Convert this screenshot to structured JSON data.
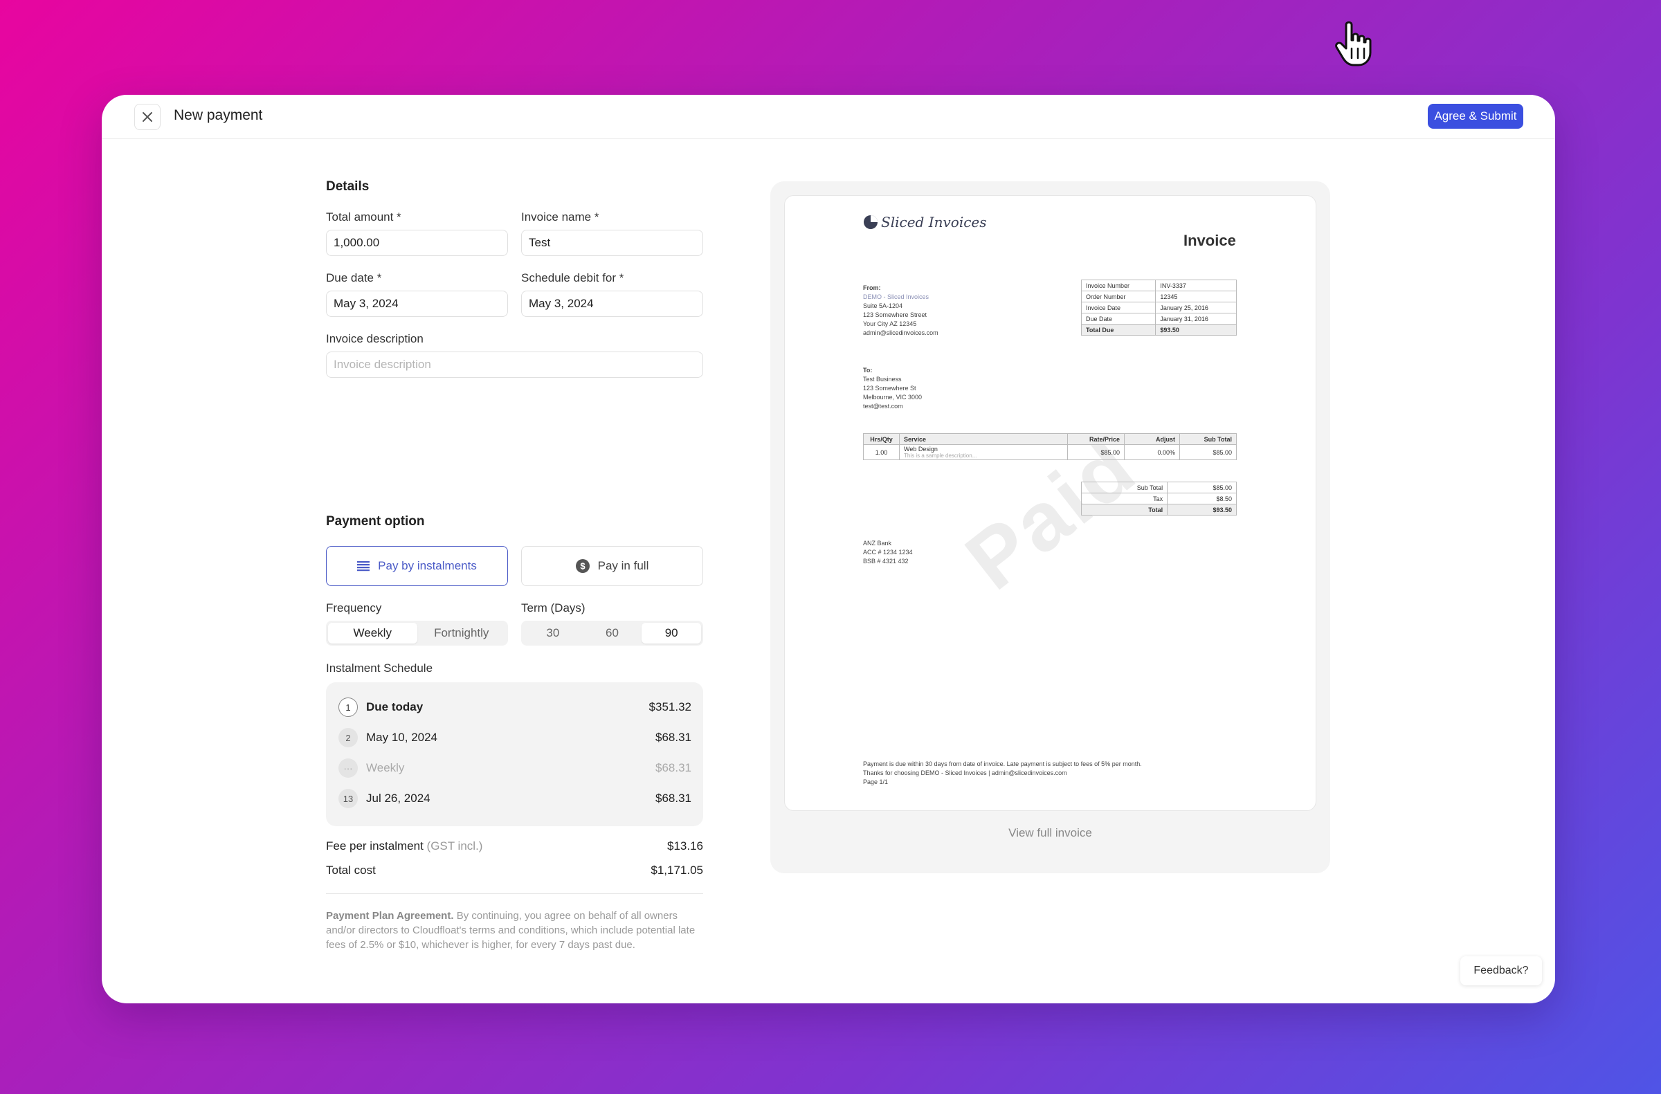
{
  "header": {
    "title": "New payment",
    "submit_label": "Agree & Submit"
  },
  "details": {
    "section_title": "Details",
    "total_amount": {
      "label": "Total amount *",
      "value": "1,000.00"
    },
    "invoice_name": {
      "label": "Invoice name *",
      "value": "Test"
    },
    "due_date": {
      "label": "Due date *",
      "value": "May 3, 2024"
    },
    "schedule_debit": {
      "label": "Schedule debit for *",
      "value": "May 3, 2024"
    },
    "description": {
      "label": "Invoice description",
      "placeholder": "Invoice description"
    }
  },
  "payment_option": {
    "section_title": "Payment option",
    "instalments_label": "Pay by instalments",
    "full_label": "Pay in full",
    "selected": "instalments",
    "frequency": {
      "label": "Frequency",
      "options": [
        "Weekly",
        "Fortnightly"
      ],
      "selected": "Weekly"
    },
    "term": {
      "label": "Term (Days)",
      "options": [
        "30",
        "60",
        "90"
      ],
      "selected": "90"
    }
  },
  "schedule": {
    "label": "Instalment Schedule",
    "rows": [
      {
        "num": "1",
        "date": "Due today",
        "amount": "$351.32"
      },
      {
        "num": "2",
        "date": "May 10, 2024",
        "amount": "$68.31"
      },
      {
        "num": "···",
        "date": "Weekly",
        "amount": "$68.31"
      },
      {
        "num": "13",
        "date": "Jul 26, 2024",
        "amount": "$68.31"
      }
    ]
  },
  "summary": {
    "fee_label": "Fee per instalment",
    "fee_note": "(GST incl.)",
    "fee_value": "$13.16",
    "total_label": "Total cost",
    "total_value": "$1,171.05"
  },
  "legal": {
    "title": "Payment Plan Agreement.",
    "body": "By continuing, you agree on behalf of all owners and/or directors to Cloudfloat's terms and conditions, which include potential late fees of 2.5% or $10, whichever is higher, for every 7 days past due."
  },
  "preview": {
    "view_full": "View full invoice",
    "logo_text": "Sliced Invoices",
    "doc_title": "Invoice",
    "watermark": "Paid",
    "from": {
      "label": "From:",
      "lines": [
        "DEMO - Sliced Invoices",
        "Suite 5A-1204",
        "123 Somewhere Street",
        "Your City AZ 12345",
        "admin@slicedinvoices.com"
      ]
    },
    "meta": [
      [
        "Invoice Number",
        "INV-3337"
      ],
      [
        "Order Number",
        "12345"
      ],
      [
        "Invoice Date",
        "January 25, 2016"
      ],
      [
        "Due Date",
        "January 31, 2016"
      ],
      [
        "Total Due",
        "$93.50"
      ]
    ],
    "to": {
      "label": "To:",
      "lines": [
        "Test Business",
        "123 Somewhere St",
        "Melbourne, VIC 3000",
        "test@test.com"
      ]
    },
    "items_head": [
      "Hrs/Qty",
      "Service",
      "Rate/Price",
      "Adjust",
      "Sub Total"
    ],
    "items": [
      {
        "qty": "1.00",
        "service": "Web Design",
        "desc": "This is a sample description...",
        "rate": "$85.00",
        "adjust": "0.00%",
        "subtotal": "$85.00"
      }
    ],
    "totals": [
      [
        "Sub Total",
        "$85.00"
      ],
      [
        "Tax",
        "$8.50"
      ],
      [
        "Total",
        "$93.50"
      ]
    ],
    "bank": [
      "ANZ Bank",
      "ACC # 1234 1234",
      "BSB # 4321 432"
    ],
    "footer": [
      "Payment is due within 30 days from date of invoice. Late payment is subject to fees of 5% per month.",
      "Thanks for choosing DEMO - Sliced Invoices | admin@slicedinvoices.com",
      "Page 1/1"
    ]
  },
  "feedback_label": "Feedback?",
  "colors": {
    "primary": "#3b4fe0",
    "accent_border": "#4b5bc7"
  }
}
